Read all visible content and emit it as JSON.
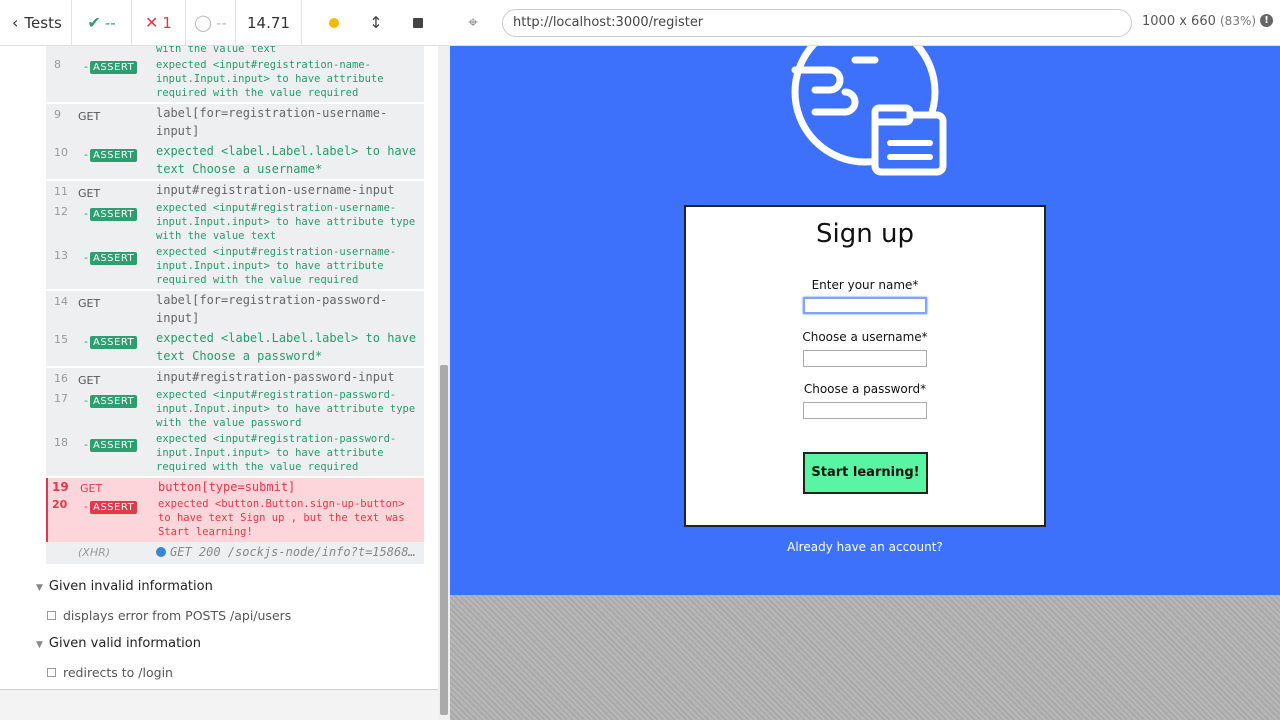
{
  "reporter": {
    "tests_label": "Tests",
    "passed": "--",
    "failed": "1",
    "pending": "--",
    "duration": "14.71",
    "commands": [
      {
        "num": "8",
        "type": "ASSERT",
        "msg_top": "with the value  text",
        "msg": "expected  <input#registration-name-input.Input.input>  to have attribute  required  with the value  required"
      },
      {
        "num": "9",
        "type": "GET",
        "msg": "label[for=registration-username-input]"
      },
      {
        "num": "10",
        "type": "ASSERT",
        "msg": "expected  <label.Label.label>  to have text  Choose a username*"
      },
      {
        "num": "11",
        "type": "GET",
        "msg": "input#registration-username-input"
      },
      {
        "num": "12",
        "type": "ASSERT",
        "msg": "expected  <input#registration-username-input.Input.input>  to have attribute  type  with the value  text"
      },
      {
        "num": "13",
        "type": "ASSERT",
        "msg": "expected  <input#registration-username-input.Input.input>  to have attribute  required  with the value  required"
      },
      {
        "num": "14",
        "type": "GET",
        "msg": "label[for=registration-password-input]"
      },
      {
        "num": "15",
        "type": "ASSERT",
        "msg": "expected  <label.Label.label>  to have text  Choose a password*"
      },
      {
        "num": "16",
        "type": "GET",
        "msg": "input#registration-password-input"
      },
      {
        "num": "17",
        "type": "ASSERT",
        "msg": "expected  <input#registration-password-input.Input.input>  to have attribute  type  with the value  password"
      },
      {
        "num": "18",
        "type": "ASSERT",
        "msg": "expected  <input#registration-password-input.Input.input>  to have attribute  required  with the value  required"
      },
      {
        "num": "19",
        "type": "GET",
        "msg": "button[type=submit]"
      },
      {
        "num": "20",
        "type": "ASSERT",
        "msg": "expected  <button.Button.sign-up-button>  to have text  Sign up , but the text was  Start learning!"
      }
    ],
    "xhr_label": "(XHR)",
    "xhr_msg": "GET 200 /sockjs-node/info?t=15868…",
    "suites": [
      {
        "title": "Given invalid information",
        "test": "displays error from POSTS /api/users"
      },
      {
        "title": "Given valid information",
        "test": "redirects to /login"
      }
    ]
  },
  "browser": {
    "url": "http://localhost:3000/register",
    "viewport": "1000 x 660",
    "zoom": "(83%)"
  },
  "app": {
    "title": "Sign up",
    "name_label": "Enter your name*",
    "username_label": "Choose a username*",
    "password_label": "Choose a password*",
    "submit_label": "Start learning!",
    "login_link": "Already have an account?"
  },
  "colors": {
    "app_bg": "#3d71fb",
    "button": "#5af5a3",
    "assert_pass": "#2c9e6f",
    "assert_fail": "#e0394a"
  }
}
